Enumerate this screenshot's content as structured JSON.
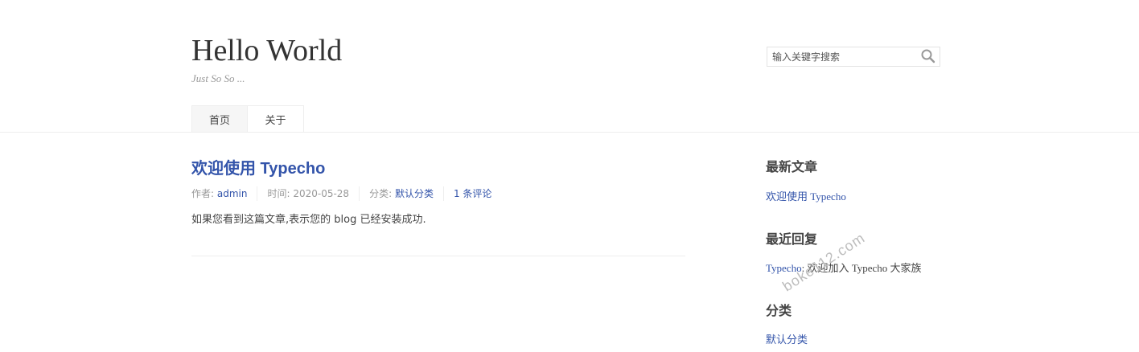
{
  "header": {
    "title": "Hello World",
    "description": "Just So So ..."
  },
  "search": {
    "placeholder": "输入关键字搜索",
    "icon": "search-icon"
  },
  "nav": {
    "items": [
      {
        "label": "首页",
        "current": true
      },
      {
        "label": "关于",
        "current": false
      }
    ]
  },
  "post": {
    "title": "欢迎使用 Typecho",
    "meta": {
      "author_label": "作者: ",
      "author": "admin",
      "time_label": "时间: ",
      "time": "2020-05-28",
      "category_label": "分类: ",
      "category": "默认分类",
      "comments": "1 条评论"
    },
    "content": "如果您看到这篇文章,表示您的 blog 已经安装成功."
  },
  "sidebar": {
    "recent_posts": {
      "title": "最新文章",
      "items": [
        "欢迎使用 Typecho"
      ]
    },
    "recent_comments": {
      "title": "最近回复",
      "items": [
        {
          "author": "Typecho",
          "text": ": 欢迎加入 Typecho 大家族"
        }
      ]
    },
    "categories": {
      "title": "分类",
      "items": [
        "默认分类"
      ]
    }
  },
  "watermark": "boke112.com",
  "colors": {
    "link": "#3354aa",
    "text": "#444444",
    "muted": "#999999",
    "border": "#eeeeee"
  }
}
